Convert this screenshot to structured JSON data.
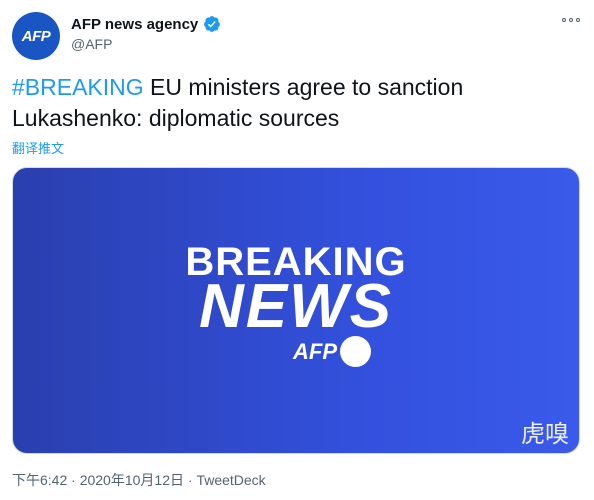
{
  "avatar": {
    "text": "AFP"
  },
  "author": {
    "display_name": "AFP news agency",
    "handle": "@AFP"
  },
  "tweet": {
    "hashtag": "#BREAKING",
    "text": " EU ministers agree to sanction Lukashenko: diplomatic sources",
    "translate_label": "翻译推文"
  },
  "media": {
    "line1": "BREAKING",
    "line2": "NEWS",
    "logo_text": "AFP",
    "watermark": "虎嗅"
  },
  "meta": {
    "timestamp": "下午6:42 · 2020年10月12日",
    "separator": " · ",
    "source": "TweetDeck"
  },
  "colors": {
    "accent": "#1d9bf0",
    "brand": "#1a55c4",
    "media_bg": "#3250dc"
  }
}
